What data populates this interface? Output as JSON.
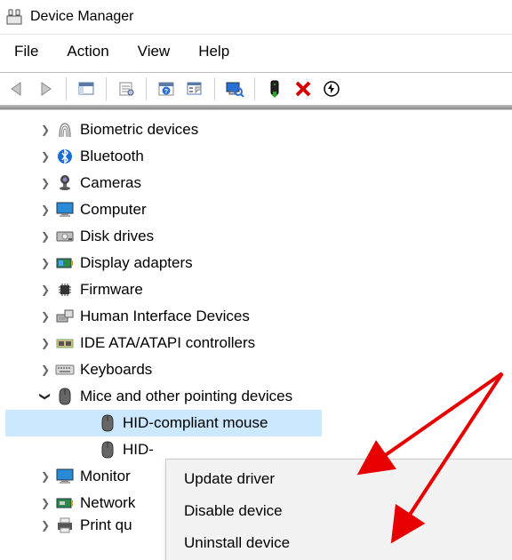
{
  "window": {
    "title": "Device Manager"
  },
  "menu": {
    "items": [
      "File",
      "Action",
      "View",
      "Help"
    ]
  },
  "tree": {
    "items": [
      {
        "label": "Biometric devices",
        "icon": "fingerprint",
        "expanded": false
      },
      {
        "label": "Bluetooth",
        "icon": "bluetooth",
        "expanded": false
      },
      {
        "label": "Cameras",
        "icon": "camera",
        "expanded": false
      },
      {
        "label": "Computer",
        "icon": "monitor",
        "expanded": false
      },
      {
        "label": "Disk drives",
        "icon": "disk",
        "expanded": false
      },
      {
        "label": "Display adapters",
        "icon": "display",
        "expanded": false
      },
      {
        "label": "Firmware",
        "icon": "chip",
        "expanded": false
      },
      {
        "label": "Human Interface Devices",
        "icon": "hid",
        "expanded": false
      },
      {
        "label": "IDE ATA/ATAPI controllers",
        "icon": "ide",
        "expanded": false
      },
      {
        "label": "Keyboards",
        "icon": "keyboard",
        "expanded": false
      },
      {
        "label": "Mice and other pointing devices",
        "icon": "mouse",
        "expanded": true,
        "children": [
          {
            "label": "HID-compliant mouse",
            "icon": "mouse",
            "selected": true
          },
          {
            "label": "HID-",
            "icon": "mouse"
          }
        ]
      },
      {
        "label": "Monitor",
        "icon": "monitor2",
        "expanded": false,
        "truncated": true,
        "original": "Monitors"
      },
      {
        "label": "Network",
        "icon": "network",
        "expanded": false,
        "truncated": true,
        "original": "Network adapters"
      },
      {
        "label": "Print qu",
        "icon": "printer",
        "expanded": false,
        "truncated": true,
        "original": "Print queues",
        "partial": true
      }
    ]
  },
  "context_menu": {
    "items": [
      "Update driver",
      "Disable device",
      "Uninstall device"
    ]
  }
}
